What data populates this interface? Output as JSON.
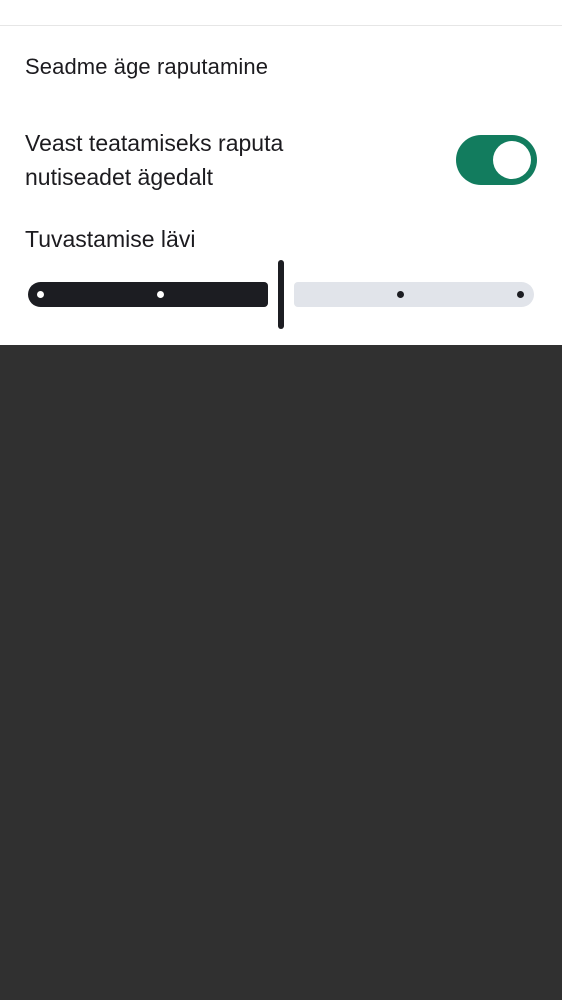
{
  "panel": {
    "title": "Seadme äge raputamine"
  },
  "shake_toggle": {
    "label": "Veast teatamiseks raputa nutiseadet ägedalt",
    "state": "on",
    "color": "#127c5e"
  },
  "threshold_slider": {
    "label": "Tuvastamise lävi",
    "steps": 5,
    "current_step": 3,
    "level_fraction": 0.5
  }
}
